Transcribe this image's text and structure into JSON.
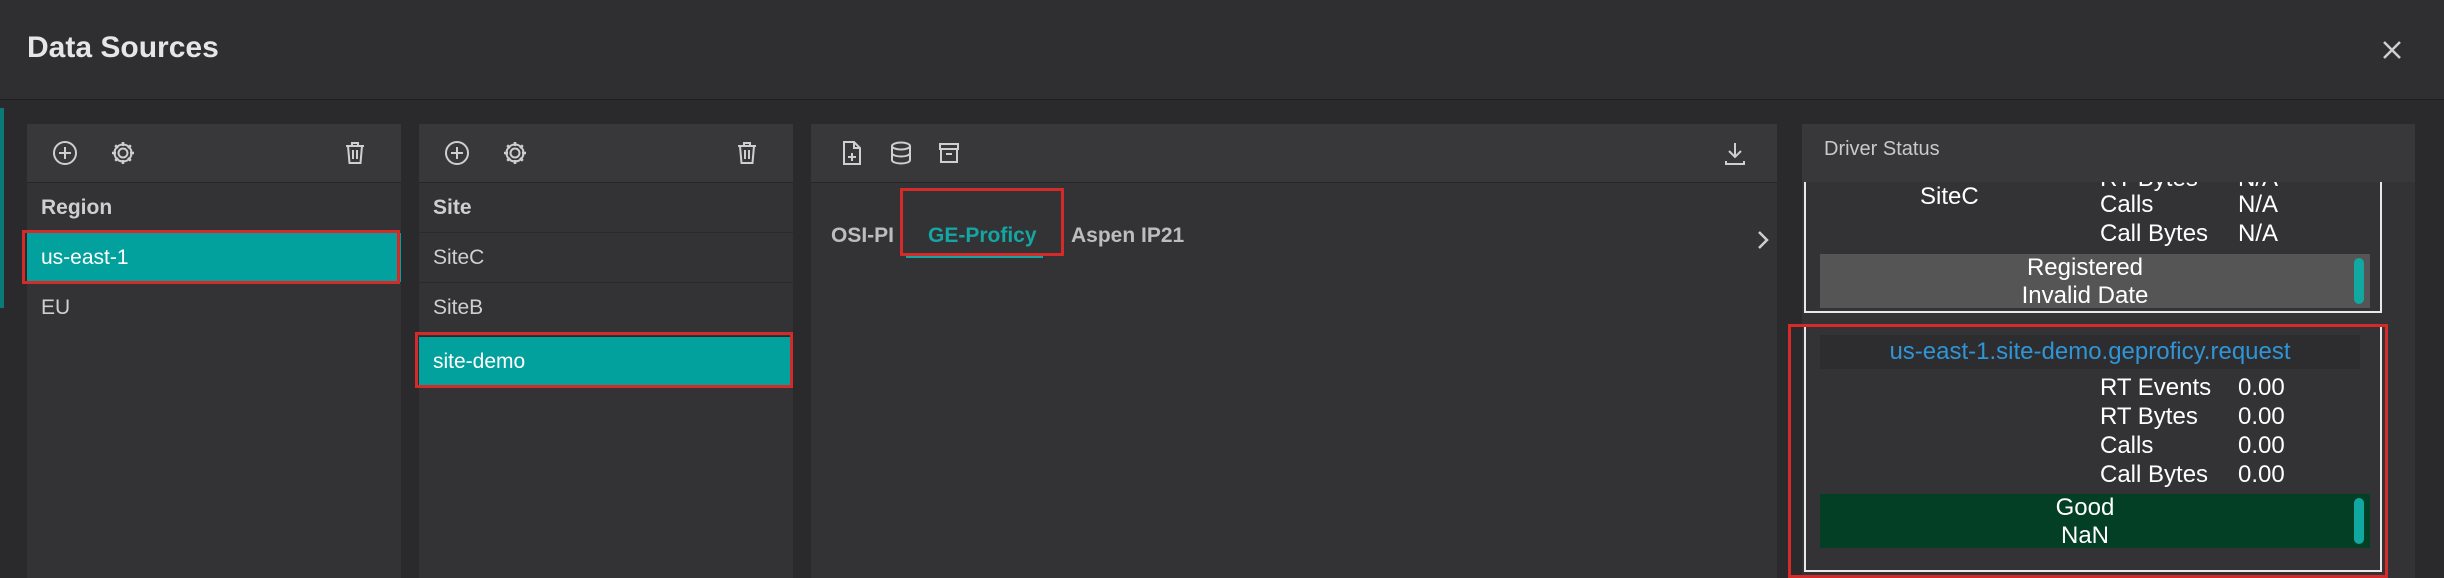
{
  "dialog": {
    "title": "Data Sources"
  },
  "region": {
    "title": "Region",
    "items": [
      {
        "label": "us-east-1",
        "selected": true
      },
      {
        "label": "EU",
        "selected": false
      }
    ]
  },
  "site": {
    "title": "Site",
    "items": [
      {
        "label": "SiteC",
        "selected": false
      },
      {
        "label": "SiteB",
        "selected": false
      },
      {
        "label": "site-demo",
        "selected": true
      }
    ]
  },
  "connectors": {
    "tabs": [
      {
        "label": "OSI-PI"
      },
      {
        "label": "GE-Proficy",
        "active": true
      },
      {
        "label": "Aspen IP21"
      }
    ]
  },
  "driver_status": {
    "title": "Driver Status",
    "card1": {
      "site": "SiteC",
      "partial_label": "RT Bytes",
      "partial_value": "N/A",
      "calls_label": "Calls",
      "calls_value": "N/A",
      "callbytes_label": "Call Bytes",
      "callbytes_value": "N/A",
      "status": "Registered",
      "date": "Invalid Date"
    },
    "card2": {
      "endpoint": "us-east-1.site-demo.geproficy.request",
      "rtevents_label": "RT Events",
      "rtevents_value": "0.00",
      "rtbytes_label": "RT Bytes",
      "rtbytes_value": "0.00",
      "calls_label": "Calls",
      "calls_value": "0.00",
      "callbytes_label": "Call Bytes",
      "callbytes_value": "0.00",
      "status": "Good",
      "date": "NaN"
    }
  },
  "colors": {
    "accent": "#03a19d",
    "highlight": "#d42a2a",
    "good": "#023f24",
    "registered": "#555555",
    "link": "#2f95d6"
  }
}
